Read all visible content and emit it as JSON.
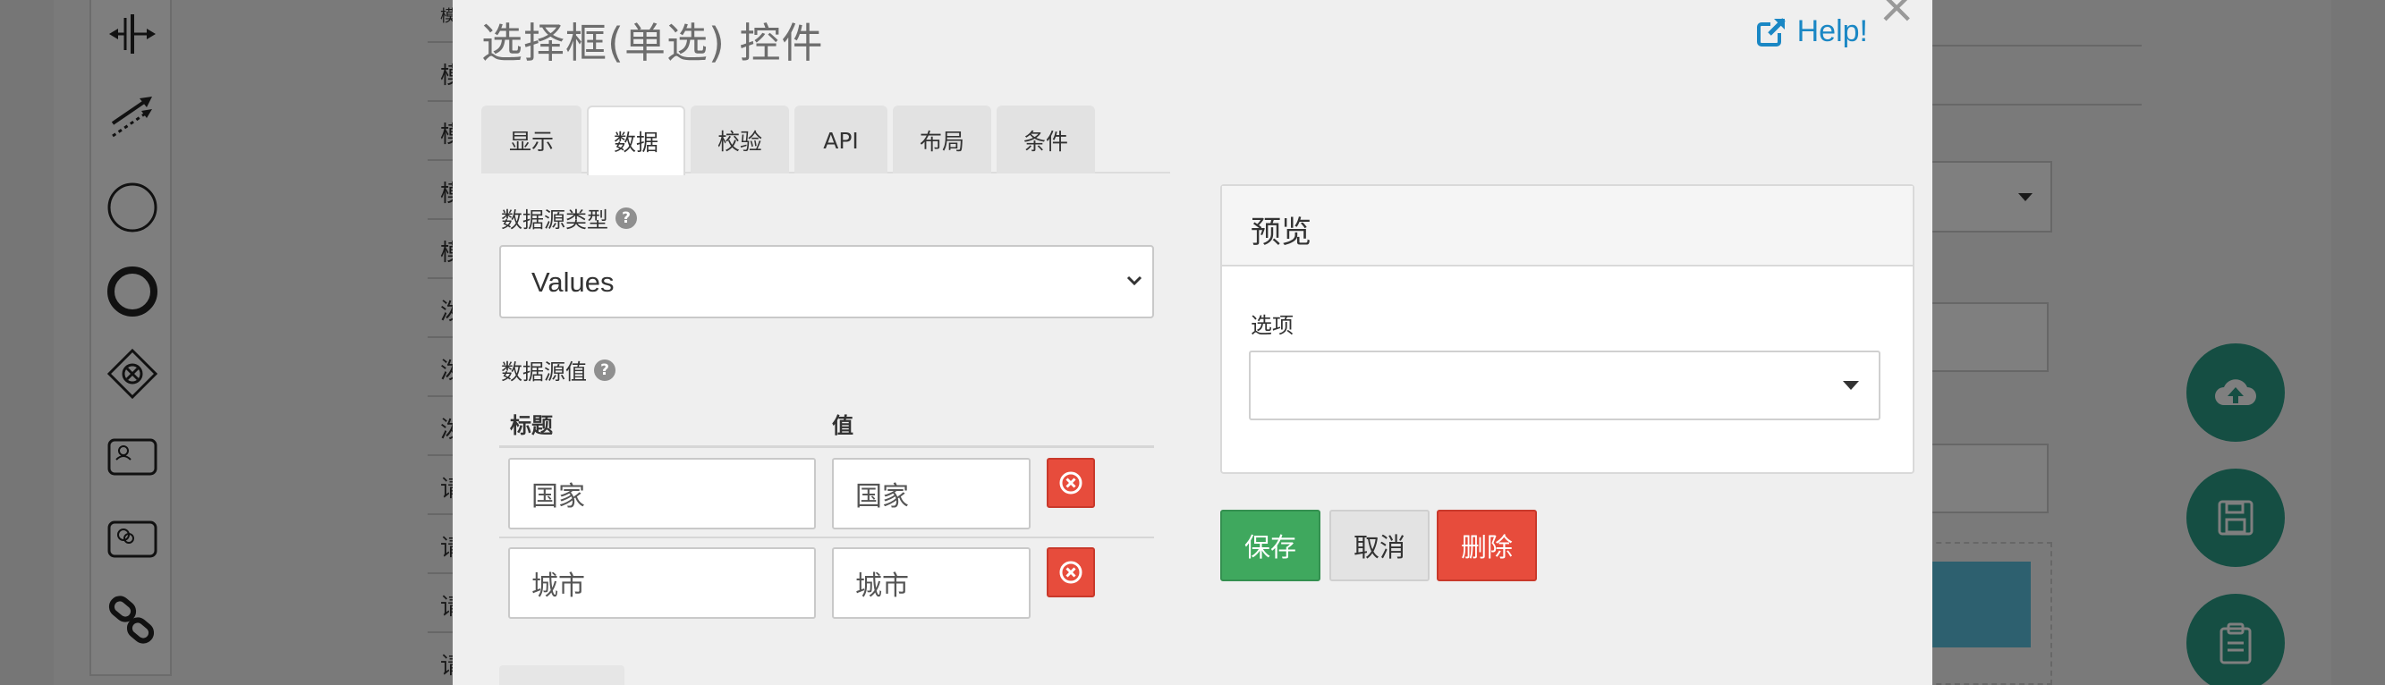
{
  "background": {
    "list_row_labels": [
      "模",
      "模",
      "模",
      "模",
      "泼",
      "泼",
      "泼",
      "请",
      "请",
      "请",
      "请"
    ],
    "palette_icons": [
      "split-icon",
      "arrows-icon",
      "circle-icon",
      "bold-circle-icon",
      "gateway-icon",
      "user-task-icon",
      "service-task-icon",
      "link-icon"
    ],
    "fab_icons": [
      "cloud-upload-icon",
      "save-icon",
      "clipboard-icon"
    ]
  },
  "modal": {
    "title": "选择框(单选) 控件",
    "help_label": "Help!",
    "close_glyph": "×",
    "tabs": [
      {
        "label": "显示"
      },
      {
        "label": "数据"
      },
      {
        "label": "校验"
      },
      {
        "label": "API"
      },
      {
        "label": "布局"
      },
      {
        "label": "条件"
      }
    ],
    "active_tab": "数据",
    "datasource_type": {
      "label": "数据源类型",
      "value": "Values"
    },
    "datasource_values": {
      "label": "数据源值",
      "col_title": "标题",
      "col_value": "值",
      "rows": [
        {
          "title": "国家",
          "value": "国家"
        },
        {
          "title": "城市",
          "value": "城市"
        }
      ]
    },
    "preview": {
      "heading": "预览",
      "field_label": "选项",
      "selected_value": ""
    },
    "buttons": {
      "save": "保存",
      "cancel": "取消",
      "delete": "删除"
    }
  },
  "colors": {
    "accent_green": "#3fa85e",
    "danger_red": "#e74c3c",
    "link_blue": "#1a87c4",
    "fab_teal": "#2a9d86"
  }
}
